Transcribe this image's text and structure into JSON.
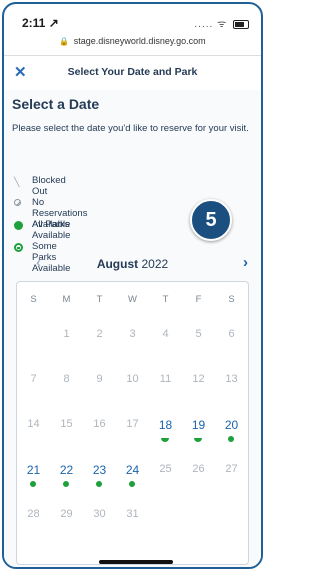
{
  "status": {
    "time": "2:11 ↗",
    "signal": "..... ᯤ"
  },
  "browser": {
    "url": "stage.disneyworld.disney.go.com"
  },
  "header": {
    "close_glyph": "✕",
    "title": "Select Your Date and Park"
  },
  "section": {
    "title": "Select a Date",
    "subtitle": "Please select the date you'd like to reserve for your visit."
  },
  "legend": [
    {
      "label": "Blocked Out",
      "icon": "slash-icon"
    },
    {
      "label": "No Reservations Available",
      "icon": "no-entry-icon"
    },
    {
      "label": "All Parks Available",
      "icon": "filled-circle-icon"
    },
    {
      "label": "Some Parks Available",
      "icon": "partial-circle-icon"
    }
  ],
  "step_badge": "5",
  "calendar": {
    "month_name": "August",
    "year": "2022",
    "prev_glyph": "‹",
    "next_glyph": "›",
    "weekdays": [
      "S",
      "M",
      "T",
      "W",
      "T",
      "F",
      "S"
    ],
    "weeks": [
      [
        {
          "d": ""
        },
        {
          "d": "1"
        },
        {
          "d": "2"
        },
        {
          "d": "3"
        },
        {
          "d": "4"
        },
        {
          "d": "5"
        },
        {
          "d": "6"
        }
      ],
      [
        {
          "d": "7"
        },
        {
          "d": "8"
        },
        {
          "d": "9"
        },
        {
          "d": "10"
        },
        {
          "d": "11"
        },
        {
          "d": "12"
        },
        {
          "d": "13"
        }
      ],
      [
        {
          "d": "14"
        },
        {
          "d": "15"
        },
        {
          "d": "16"
        },
        {
          "d": "17"
        },
        {
          "d": "18",
          "state": "some"
        },
        {
          "d": "19",
          "state": "some"
        },
        {
          "d": "20",
          "state": "all"
        }
      ],
      [
        {
          "d": "21",
          "state": "all"
        },
        {
          "d": "22",
          "state": "all"
        },
        {
          "d": "23",
          "state": "all"
        },
        {
          "d": "24",
          "state": "all"
        },
        {
          "d": "25"
        },
        {
          "d": "26"
        },
        {
          "d": "27"
        }
      ],
      [
        {
          "d": "28"
        },
        {
          "d": "29"
        },
        {
          "d": "30"
        },
        {
          "d": "31"
        },
        {
          "d": ""
        },
        {
          "d": ""
        },
        {
          "d": ""
        }
      ]
    ]
  },
  "colors": {
    "brand_blue": "#1a63ad",
    "available_green": "#1ea03c",
    "text_navy": "#253b56"
  }
}
